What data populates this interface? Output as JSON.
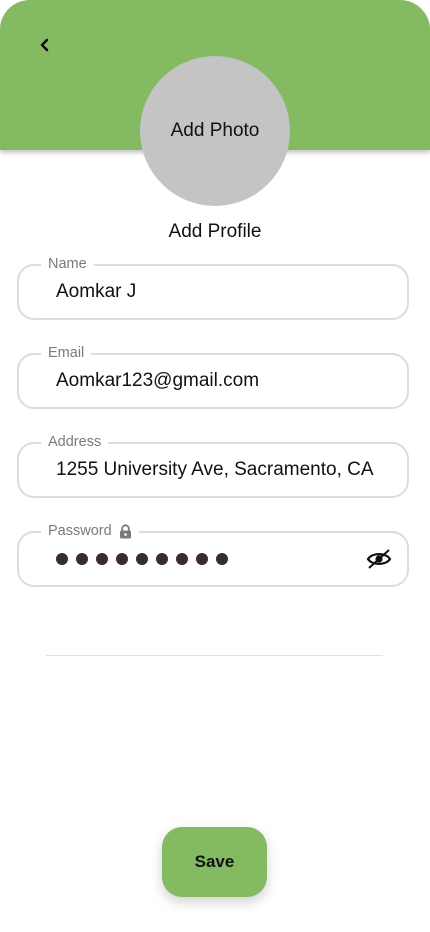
{
  "header": {
    "back_icon": "chevron-left-icon",
    "photo_label": "Add Photo",
    "background_color": "#84bb62"
  },
  "page_title": "Add Profile",
  "form": {
    "name": {
      "label": "Name",
      "value": "Aomkar J"
    },
    "email": {
      "label": "Email",
      "value": "Aomkar123@gmail.com"
    },
    "address": {
      "label": "Address",
      "value": "1255 University Ave, Sacramento, CA"
    },
    "password": {
      "label": "Password",
      "label_icon": "lock-icon",
      "masked_length": 9,
      "visibility_icon": "eye-slash-icon"
    }
  },
  "save_button": {
    "label": "Save",
    "color": "#84bb62"
  }
}
